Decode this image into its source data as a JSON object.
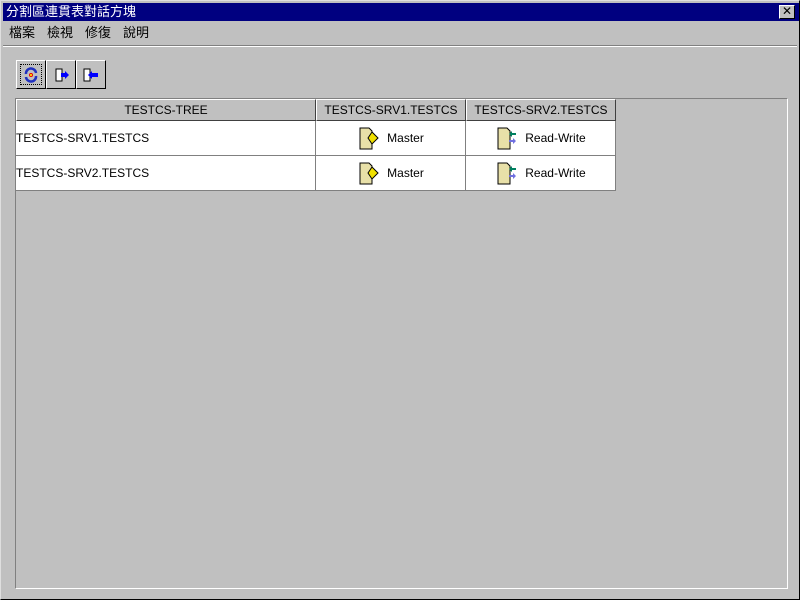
{
  "window": {
    "title": "分割區連貫表對話方塊",
    "close_label": "✕"
  },
  "menu": [
    "檔案",
    "檢視",
    "修復",
    "說明"
  ],
  "toolbar": {
    "colors": {
      "accent": "#000080"
    }
  },
  "table": {
    "headers": [
      "TESTCS-TREE",
      "TESTCS-SRV1.TESTCS",
      "TESTCS-SRV2.TESTCS"
    ],
    "rows": [
      {
        "name": "TESTCS-SRV1.TESTCS",
        "cells": [
          "Master",
          "Read-Write"
        ]
      },
      {
        "name": "TESTCS-SRV2.TESTCS",
        "cells": [
          "Master",
          "Read-Write"
        ]
      }
    ]
  }
}
